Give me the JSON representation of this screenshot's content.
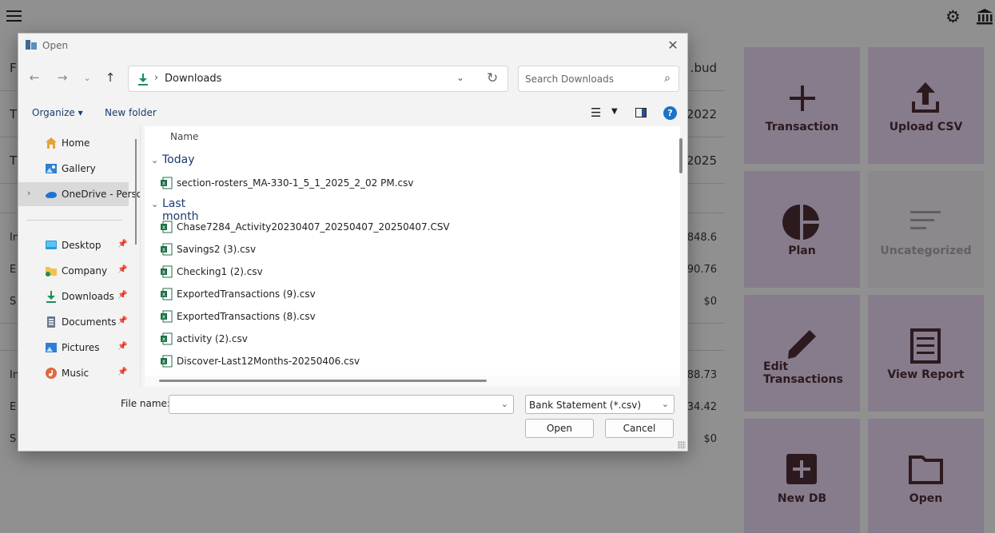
{
  "app": {
    "left_rows": [
      {
        "label": "F",
        "value": ".bud"
      },
      {
        "label": "T",
        "value": "2022"
      },
      {
        "label": "T",
        "value": "2025"
      }
    ],
    "summary_a": [
      {
        "label": "In",
        "value": "848.6"
      },
      {
        "label": "E",
        "value": "90.76"
      },
      {
        "label": "S",
        "value": "$0"
      }
    ],
    "summary_b": [
      {
        "label": "In",
        "value": "88.73"
      },
      {
        "label": "E",
        "value": "34.42"
      },
      {
        "label": "S",
        "value": "$0"
      }
    ],
    "tiles": [
      {
        "label": "Transaction",
        "icon": "plus-icon"
      },
      {
        "label": "Upload CSV",
        "icon": "upload-icon"
      },
      {
        "label": "Plan",
        "icon": "pie-chart-icon"
      },
      {
        "label": "Uncategorized",
        "icon": "list-lines-icon"
      },
      {
        "label": "Edit Transactions",
        "icon": "pencil-icon"
      },
      {
        "label": "View Report",
        "icon": "receipt-icon"
      },
      {
        "label": "New DB",
        "icon": "add-box-icon"
      },
      {
        "label": "Open",
        "icon": "folder-icon"
      }
    ],
    "accent": "#d9c8e0",
    "icon_color": "#4a2a33"
  },
  "dialog": {
    "title": "Open",
    "address": {
      "path": "Downloads"
    },
    "search": {
      "placeholder": "Search Downloads"
    },
    "toolbar": {
      "organize": "Organize ▾",
      "new_folder": "New folder",
      "help": "?"
    },
    "nav_items": [
      {
        "label": "Home",
        "icon": "home-icon"
      },
      {
        "label": "Gallery",
        "icon": "gallery-icon"
      },
      {
        "label": "OneDrive - Personal",
        "icon": "cloud-icon"
      },
      {
        "label": "Desktop",
        "icon": "desktop-icon"
      },
      {
        "label": "Company",
        "icon": "folder-icon"
      },
      {
        "label": "Downloads",
        "icon": "download-icon"
      },
      {
        "label": "Documents",
        "icon": "documents-icon"
      },
      {
        "label": "Pictures",
        "icon": "pictures-icon"
      },
      {
        "label": "Music",
        "icon": "music-icon"
      }
    ],
    "column_name": "Name",
    "groups": [
      {
        "label": "Today"
      },
      {
        "label": "Last month"
      }
    ],
    "files_today": [
      "section-rosters_MA-330-1_5_1_2025_2_02 PM.csv"
    ],
    "files_last_month": [
      "Chase7284_Activity20230407_20250407_20250407.CSV",
      "Savings2 (3).csv",
      "Checking1 (2).csv",
      "ExportedTransactions (9).csv",
      "ExportedTransactions (8).csv",
      "activity (2).csv",
      "Discover-Last12Months-20250406.csv"
    ],
    "file_name_label": "File name:",
    "file_name_value": "",
    "filter": "Bank Statement (*.csv)",
    "open_button": "Open",
    "cancel_button": "Cancel"
  }
}
